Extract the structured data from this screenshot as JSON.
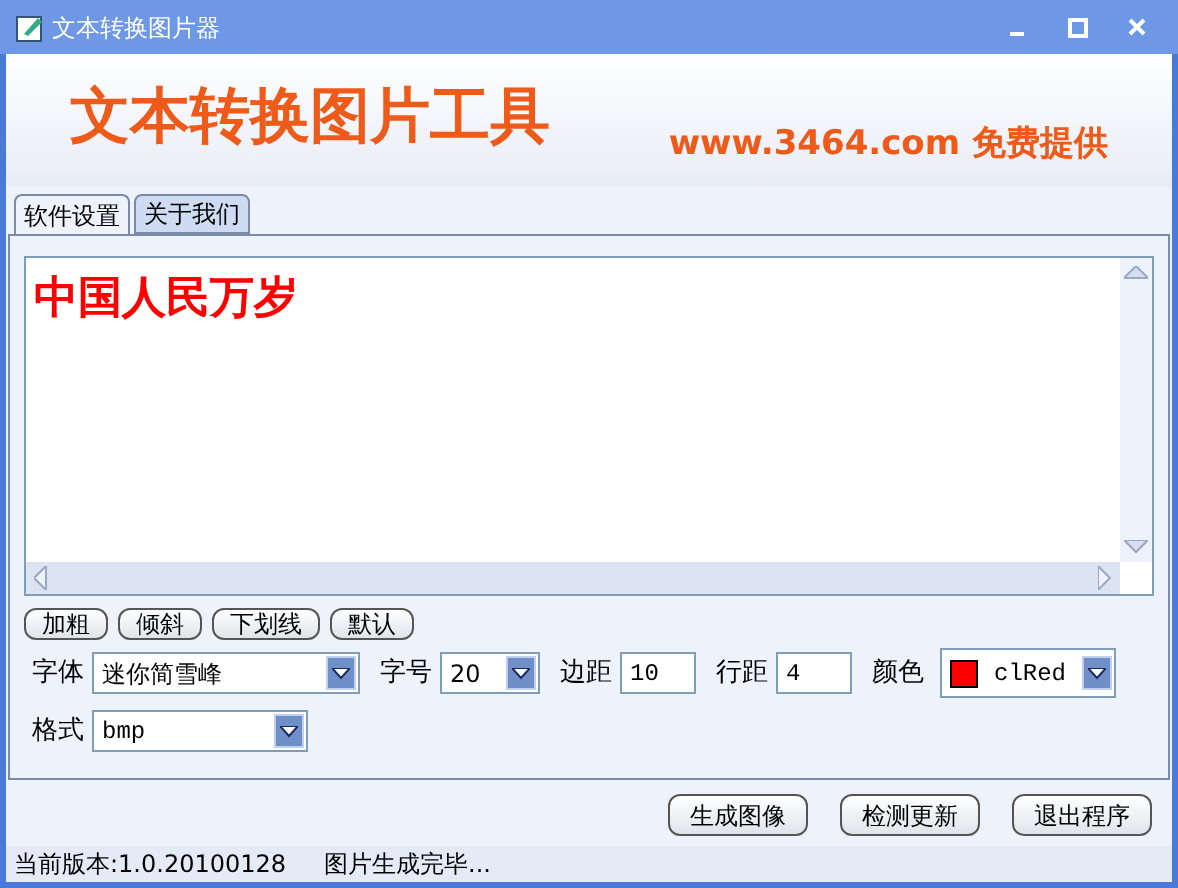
{
  "window": {
    "title": "文本转换图片器"
  },
  "banner": {
    "title": "文本转换图片工具",
    "tagline": "www.3464.com 免费提供"
  },
  "tabs": [
    {
      "label": "软件设置",
      "selected": true
    },
    {
      "label": "关于我们",
      "selected": false
    }
  ],
  "preview": {
    "text": "中国人民万岁",
    "color": "#ff0000"
  },
  "style_buttons": [
    "加粗",
    "倾斜",
    "下划线",
    "默认"
  ],
  "settings": [
    {
      "kind": "dropdown",
      "label": "字体",
      "value": "迷你简雪峰"
    },
    {
      "kind": "dropdown",
      "label": "字号",
      "value": "20"
    },
    {
      "kind": "input",
      "label": "边距",
      "value": "10"
    },
    {
      "kind": "input",
      "label": "行距",
      "value": "4"
    },
    {
      "kind": "color",
      "label": "颜色",
      "value": "clRed",
      "color": "#ff0000"
    }
  ],
  "format": {
    "label": "格式",
    "value": "bmp"
  },
  "actions": [
    "生成图像",
    "检测更新",
    "退出程序"
  ],
  "status_bar": [
    "当前版本:1.0.20100128",
    "图片生成完毕..."
  ]
}
